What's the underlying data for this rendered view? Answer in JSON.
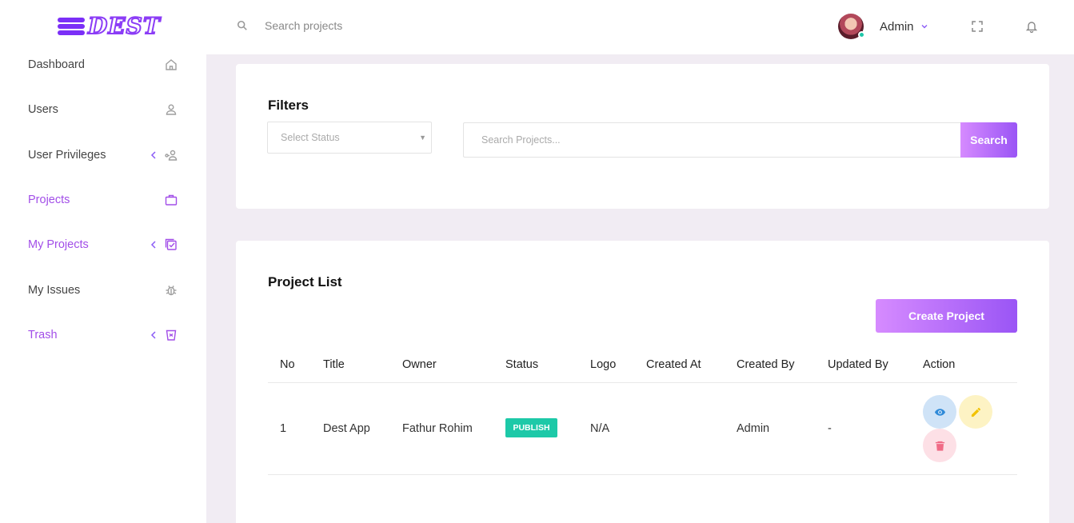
{
  "app": {
    "logo_text": "DEST"
  },
  "topbar": {
    "search_placeholder": "Search projects",
    "user_name": "Admin"
  },
  "sidebar": {
    "items": [
      {
        "label": "Dashboard",
        "icon": "home-icon",
        "active": false,
        "expandable": false
      },
      {
        "label": "Users",
        "icon": "user-icon",
        "active": false,
        "expandable": false
      },
      {
        "label": "User Privileges",
        "icon": "user-key-icon",
        "active": false,
        "expandable": true
      },
      {
        "label": "Projects",
        "icon": "briefcase-icon",
        "active": true,
        "expandable": false
      },
      {
        "label": "My Projects",
        "icon": "checklist-icon",
        "active": true,
        "expandable": true
      },
      {
        "label": "My Issues",
        "icon": "bug-icon",
        "active": false,
        "expandable": false
      },
      {
        "label": "Trash",
        "icon": "trash-icon",
        "active": true,
        "expandable": true
      }
    ]
  },
  "filters": {
    "title": "Filters",
    "status_placeholder": "Select Status",
    "search_placeholder": "Search Projects...",
    "search_button": "Search"
  },
  "project_list": {
    "title": "Project List",
    "create_button": "Create Project",
    "columns": [
      "No",
      "Title",
      "Owner",
      "Status",
      "Logo",
      "Created At",
      "Created By",
      "Updated By",
      "Action"
    ],
    "rows": [
      {
        "no": "1",
        "title": "Dest App",
        "owner": "Fathur Rohim",
        "status": "PUBLISH",
        "logo": "N/A",
        "created_at": "",
        "created_by": "Admin",
        "updated_by": "-"
      }
    ]
  },
  "colors": {
    "accent": "#a24ee8",
    "gradient_start": "#d68bff",
    "gradient_end": "#9a55f5",
    "status_publish": "#1dc9a8",
    "view_bg": "#cfe3f7",
    "edit_bg": "#fdf3c4",
    "delete_bg": "#fde0e6"
  }
}
